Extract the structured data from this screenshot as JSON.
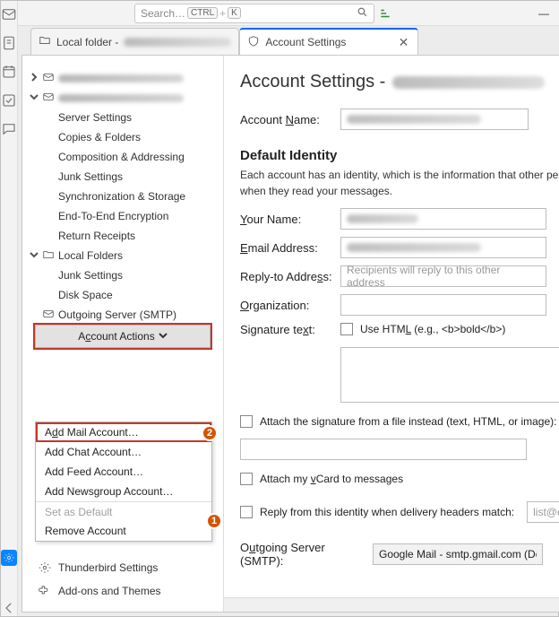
{
  "search": {
    "placeholder": "Search…",
    "kbd1": "CTRL",
    "kbd2": "K"
  },
  "tabs": {
    "local": "Local folder - ",
    "settings": "Account Settings"
  },
  "tree": {
    "items": [
      "Server Settings",
      "Copies & Folders",
      "Composition & Addressing",
      "Junk Settings",
      "Synchronization & Storage",
      "End-To-End Encryption",
      "Return Receipts"
    ],
    "local_folders": "Local Folders",
    "local_items": [
      "Junk Settings",
      "Disk Space"
    ],
    "smtp": "Outgoing Server (SMTP)"
  },
  "menu": {
    "add_mail_pre": "A",
    "add_mail_u": "d",
    "add_mail_post": "d Mail Account…",
    "add_chat": "Add Chat Account…",
    "add_feed": "Add Feed Account…",
    "add_news": "Add Newsgroup Account…",
    "set_default": "Set as Default",
    "remove": "Remove Account",
    "actions_pre": "A",
    "actions_u": "c",
    "actions_post": "count Actions"
  },
  "badges": {
    "one": "1",
    "two": "2"
  },
  "sblinks": {
    "tb": "Thunderbird Settings",
    "addons": "Add-ons and Themes"
  },
  "panel": {
    "heading": "Account Settings - ",
    "acct_name_pre": "Account ",
    "acct_name_u": "N",
    "acct_name_post": "ame:",
    "section": "Default Identity",
    "desc": "Each account has an identity, which is the information that other people see when they read your messages.",
    "your_name_u": "Y",
    "your_name_post": "our Name:",
    "email_u": "E",
    "email_post": "mail Address:",
    "reply_pre": "Reply-to Addre",
    "reply_u": "s",
    "reply_post": "s:",
    "reply_placeholder": "Recipients will reply to this other address",
    "org_u": "O",
    "org_post": "rganization:",
    "sig_pre": "Signature te",
    "sig_u": "x",
    "sig_post": "t:",
    "use_html_pre": "Use HTM",
    "use_html_u": "L",
    "use_html_post": " (e.g., <b>bold</b>)",
    "attach_sig": "Attach the signature from a file instead (text, HTML, or image):",
    "attach_vcard_pre": "Attach my ",
    "attach_vcard_u": "v",
    "attach_vcard_post": "Card to messages",
    "reply_from": "Reply from this identity when delivery headers match:",
    "reply_from_val": "list@example.com",
    "smtp_pre": "O",
    "smtp_u": "u",
    "smtp_post": "tgoing Server (SMTP):",
    "smtp_val": "Google Mail - smtp.gmail.com (Default)"
  }
}
